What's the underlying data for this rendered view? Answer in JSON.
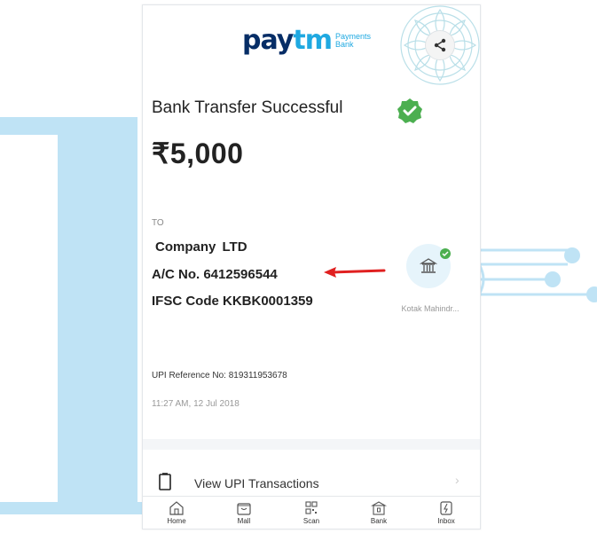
{
  "header": {
    "logo_main_1": "pay",
    "logo_main_2": "tm",
    "logo_sub_1": "Payments",
    "logo_sub_2": "Bank",
    "share_icon": "share-icon"
  },
  "receipt": {
    "status": "Bank Transfer Successful",
    "amount": "₹5,000",
    "to_label": "TO",
    "company": "Company LTD",
    "account_number": "A/C No. 6412596544",
    "ifsc": "IFSC Code KKBK0001359",
    "bank_name": "Kotak Mahindr...",
    "upi_reference": "UPI Reference No: 819311953678",
    "timestamp": "11:27 AM, 12 Jul 2018"
  },
  "view_upi": {
    "label": "View UPI Transactions",
    "chevron": "›"
  },
  "bottom_nav": {
    "items": [
      {
        "label": "Home",
        "icon": "home-icon"
      },
      {
        "label": "Mall",
        "icon": "mall-icon"
      },
      {
        "label": "Scan",
        "icon": "scan-icon"
      },
      {
        "label": "Bank",
        "icon": "bank-icon"
      },
      {
        "label": "Inbox",
        "icon": "inbox-icon"
      }
    ]
  },
  "colors": {
    "brand_dark": "#062d66",
    "brand_light": "#1fa9e1",
    "success": "#4caf50",
    "arrow": "#e02020",
    "deco": "#bfe3f5"
  }
}
